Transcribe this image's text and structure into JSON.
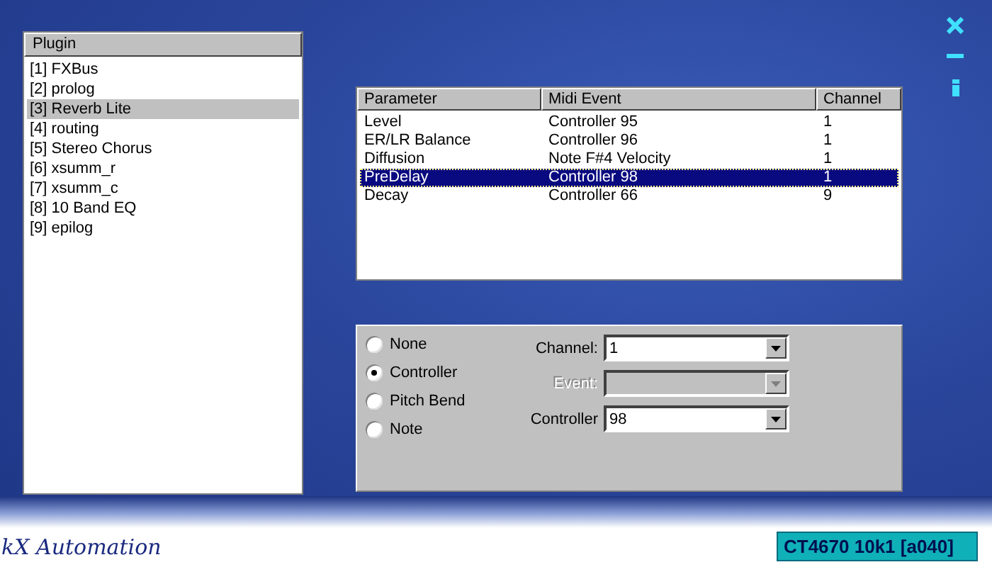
{
  "plugin_list": {
    "header": "Plugin",
    "items": [
      {
        "label": "[1] FXBus",
        "selected": false
      },
      {
        "label": "[2] prolog",
        "selected": false
      },
      {
        "label": "[3] Reverb Lite",
        "selected": true
      },
      {
        "label": "[4] routing",
        "selected": false
      },
      {
        "label": "[5] Stereo Chorus",
        "selected": false
      },
      {
        "label": "[6] xsumm_r",
        "selected": false
      },
      {
        "label": "[7] xsumm_c",
        "selected": false
      },
      {
        "label": "[8] 10 Band EQ",
        "selected": false
      },
      {
        "label": "[9] epilog",
        "selected": false
      }
    ]
  },
  "parameter_table": {
    "columns": [
      "Parameter",
      "Midi Event",
      "Channel"
    ],
    "rows": [
      {
        "cells": [
          "Level",
          "Controller 95",
          "1"
        ],
        "selected": false
      },
      {
        "cells": [
          "ER/LR Balance",
          "Controller 96",
          "1"
        ],
        "selected": false
      },
      {
        "cells": [
          "Diffusion",
          "Note F#4 Velocity",
          "1"
        ],
        "selected": false
      },
      {
        "cells": [
          "PreDelay",
          "Controller 98",
          "1"
        ],
        "selected": true
      },
      {
        "cells": [
          "Decay",
          "Controller 66",
          "9"
        ],
        "selected": false
      }
    ]
  },
  "event_type": [
    {
      "label": "None",
      "selected": false
    },
    {
      "label": "Controller",
      "selected": true
    },
    {
      "label": "Pitch Bend",
      "selected": false
    },
    {
      "label": "Note",
      "selected": false
    }
  ],
  "fields": [
    {
      "label": "Channel:",
      "value": "1",
      "disabled": false
    },
    {
      "label": "Event:",
      "disabled": true
    },
    {
      "label": "Controller",
      "value": "98",
      "disabled": false
    }
  ],
  "footer": {
    "title": "kX Automation",
    "device": "CT4670 10k1 [a040]"
  }
}
